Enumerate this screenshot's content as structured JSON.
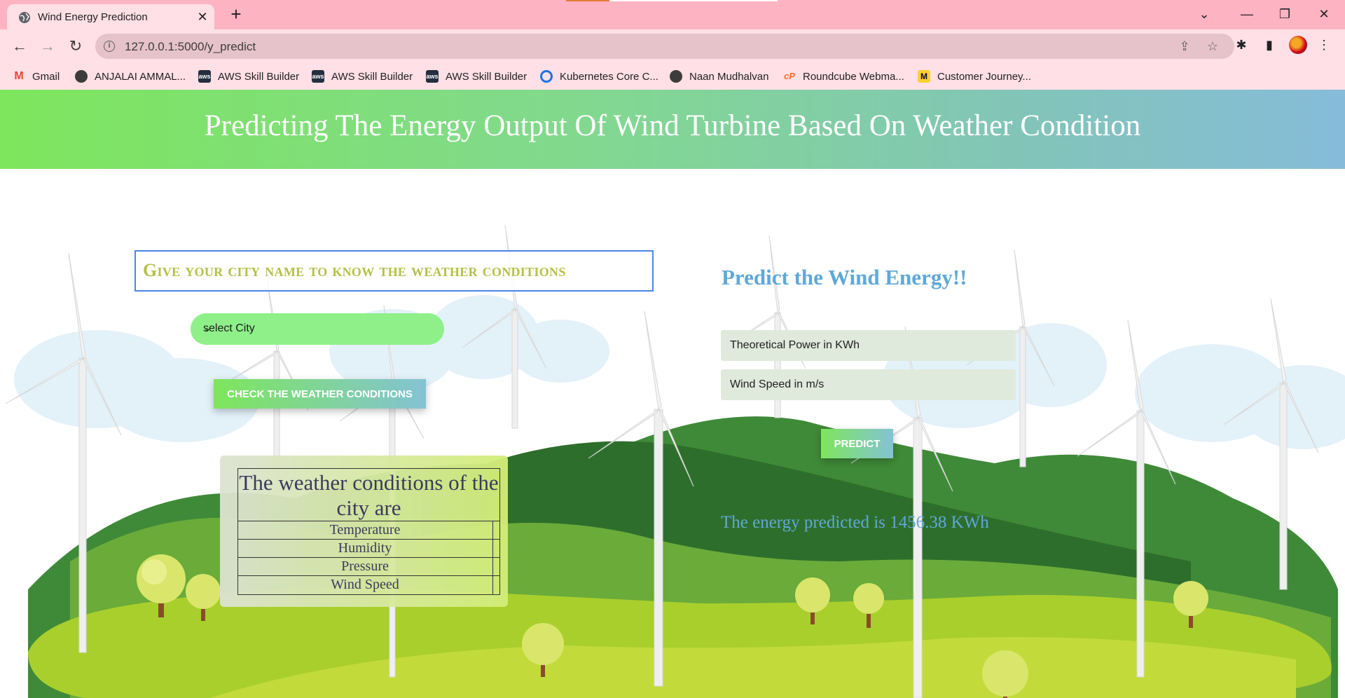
{
  "browser": {
    "tab_title": "Wind Energy Prediction",
    "url": "127.0.0.1:5000/y_predict",
    "bookmarks": [
      {
        "label": "Gmail",
        "icon": "gmail-icon",
        "color": "#ea4335"
      },
      {
        "label": "ANJALAI AMMAL...",
        "icon": "globe-icon",
        "color": "#202124"
      },
      {
        "label": "AWS Skill Builder",
        "icon": "aws-icon",
        "color": "#232f3e"
      },
      {
        "label": "AWS Skill Builder",
        "icon": "aws-icon",
        "color": "#232f3e"
      },
      {
        "label": "AWS Skill Builder",
        "icon": "aws-icon",
        "color": "#232f3e"
      },
      {
        "label": "Kubernetes Core C...",
        "icon": "kubernetes-icon",
        "color": "#1a73e8"
      },
      {
        "label": "Naan Mudhalvan",
        "icon": "globe-icon",
        "color": "#202124"
      },
      {
        "label": "Roundcube Webma...",
        "icon": "cpanel-icon",
        "color": "#ff6c2c"
      },
      {
        "label": "Customer Journey...",
        "icon": "miro-icon",
        "color": "#ffd02f"
      }
    ]
  },
  "header": {
    "title": "Predicting The Energy Output Of Wind Turbine Based On Weather Condition"
  },
  "weather_section": {
    "prompt": "Give your city name to know the weather conditions",
    "select_value": "select City",
    "check_button": "CHECK THE WEATHER CONDITIONS",
    "table_caption": "The weather conditions of the city are",
    "rows": [
      "Temperature",
      "Humidity",
      "Pressure",
      "Wind Speed"
    ]
  },
  "predict_section": {
    "title": "Predict the Wind Energy!!",
    "theoretical_power_placeholder": "Theoretical Power in KWh",
    "wind_speed_placeholder": "Wind Speed in m/s",
    "predict_button": "PREDICT",
    "result": "The energy predicted is 1456.38 KWh"
  },
  "colors": {
    "header_gradient_start": "#7de65c",
    "header_gradient_end": "#86bcd9",
    "accent_blue": "#5fa8d8",
    "prompt_olive": "#b5c046",
    "select_green": "#8ff08a"
  }
}
